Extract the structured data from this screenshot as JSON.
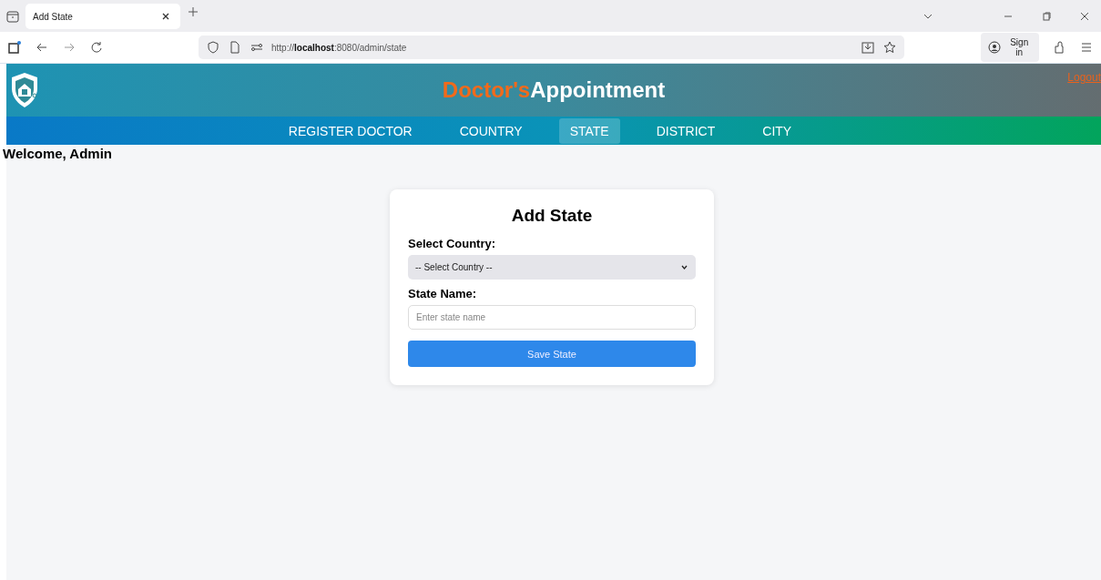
{
  "browser": {
    "tab_title": "Add State",
    "url": "http://**localhost**:8080/admin/state",
    "sign_in": "Sign in"
  },
  "header": {
    "title_accent": "Doctor's",
    "title_main": "Appointment",
    "logout": "Logout"
  },
  "nav": [
    {
      "label": "REGISTER DOCTOR",
      "selected": false
    },
    {
      "label": "COUNTRY",
      "selected": false
    },
    {
      "label": "STATE",
      "selected": true
    },
    {
      "label": "DISTRICT",
      "selected": false
    },
    {
      "label": "CITY",
      "selected": false
    }
  ],
  "welcome": "Welcome, Admin",
  "form": {
    "title": "Add State",
    "country_label": "Select Country:",
    "country_value": "-- Select Country --",
    "state_label": "State Name:",
    "state_placeholder": "Enter state name",
    "submit": "Save State"
  }
}
